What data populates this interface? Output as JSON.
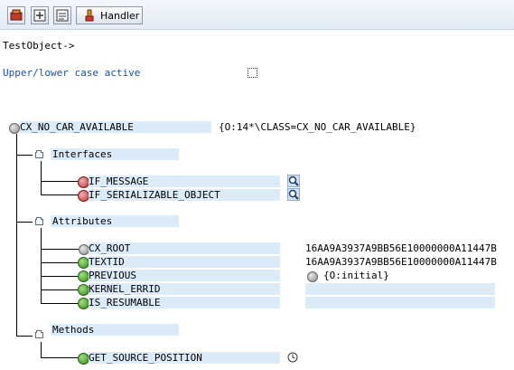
{
  "toolbar": {
    "handler_label": "Handler",
    "icons": [
      "object-icon",
      "add-icon",
      "list-icon",
      "handler-icon"
    ]
  },
  "header": {
    "object_label": "TestObject->",
    "case_label": "Upper/lower case active"
  },
  "tree": {
    "root": {
      "name": "CX_NO_CAR_AVAILABLE",
      "value": "{O:14*\\CLASS=CX_NO_CAR_AVAILABLE}"
    },
    "interfaces": {
      "label": "Interfaces",
      "items": [
        "IF_MESSAGE",
        "IF_SERIALIZABLE_OBJECT"
      ]
    },
    "attributes": {
      "label": "Attributes",
      "items": [
        {
          "name": "CX_ROOT",
          "value": "16AA9A3937A9BB56E10000000A11447B",
          "icon": "gray"
        },
        {
          "name": "TEXTID",
          "value": "16AA9A3937A9BB56E10000000A11447B",
          "icon": "green"
        },
        {
          "name": "PREVIOUS",
          "value": "{O:initial}",
          "icon": "green"
        },
        {
          "name": "KERNEL_ERRID",
          "value": "",
          "icon": "green"
        },
        {
          "name": "IS_RESUMABLE",
          "value": "",
          "icon": "green"
        }
      ]
    },
    "methods": {
      "label": "Methods",
      "items": [
        "GET_SOURCE_POSITION"
      ]
    }
  },
  "colors": {
    "highlight": "#dcebf8",
    "label_blue": "#1a4f9e",
    "toolbar_bg": "#e3ebf3"
  }
}
